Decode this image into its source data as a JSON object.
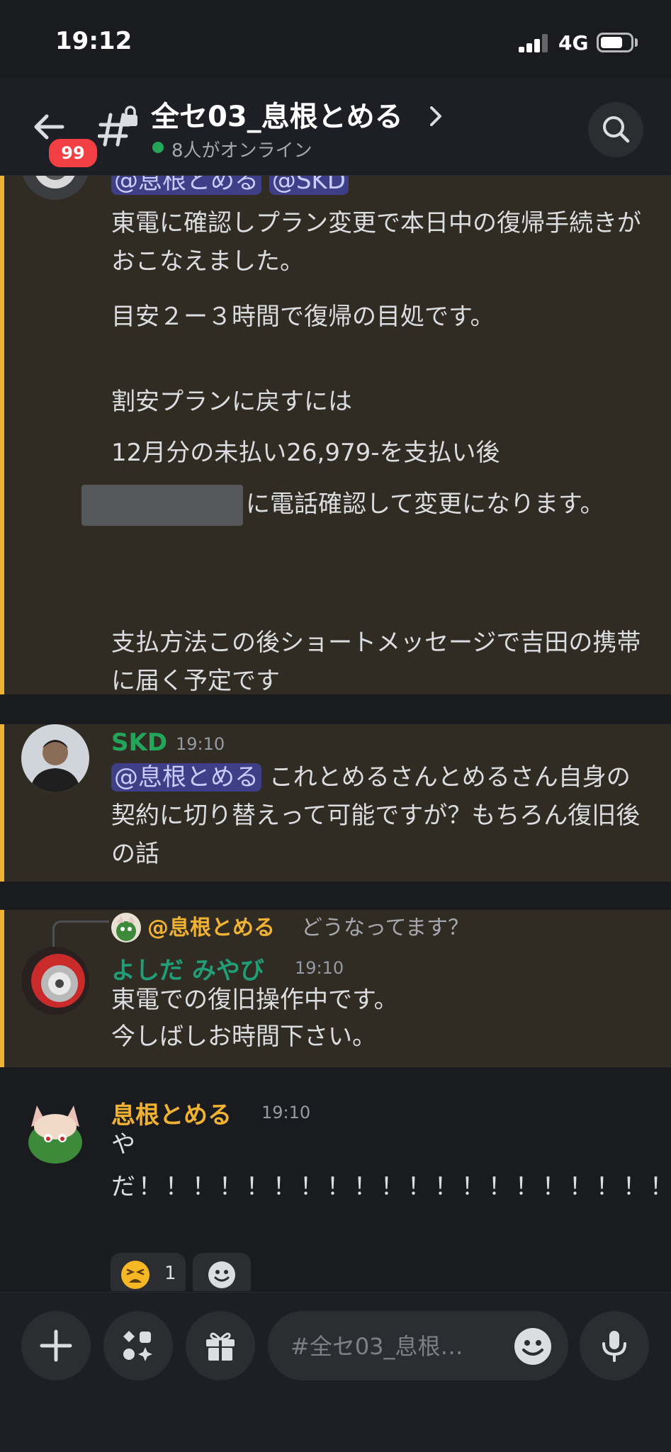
{
  "status_bar": {
    "time": "19:12",
    "network": "4G"
  },
  "header": {
    "unread_badge": "99",
    "channel_name": "全セ03_息根とめる",
    "online_text": "8人がオンライン"
  },
  "messages": {
    "first": {
      "mentions": [
        "@息根とめる",
        "@SKD"
      ],
      "line1": "東電に確認しプラン変更で本日中の復帰手続きがおこなえました。",
      "line2": "目安２ー３時間で復帰の目処です。",
      "line3": "割安プランに戻すには",
      "line4": "12月分の未払い26,979-を支払い後",
      "line5": "に電話確認して変更になります。",
      "line6": "支払方法この後ショートメッセージで吉田の携帯に届く予定です"
    },
    "skd": {
      "username": "SKD",
      "timestamp": "19:10",
      "mention": "@息根とめる",
      "text": " これとめるさんとめるさん自身の契約に切り替えって可能ですが？もちろん復旧後の話"
    },
    "yoshida": {
      "reply_name": "@息根とめる",
      "reply_text": "どうなってます？",
      "username": "よしだ みやび",
      "timestamp": "19:10",
      "line1": "東電での復旧操作中です。",
      "line2": "今しばしお時間下さい。"
    },
    "ikine": {
      "username": "息根とめる",
      "timestamp": "19:10",
      "line1": "や",
      "line2": "だ！！！！！！！！！！！！！！！！！！！！！！！！！！",
      "reaction_count": "1"
    }
  },
  "composer": {
    "placeholder": "#全セ03_息根…"
  },
  "colors": {
    "highlight_bg": "#302b23",
    "highlight_bar": "#f0b232",
    "skd_name": "#23a55a",
    "yoshida_name": "#1f9e78",
    "ikine_name": "#f0b232",
    "mention_bg": "#3d3f87"
  },
  "icons": [
    "back-arrow-icon",
    "hash-lock-icon",
    "chevron-right-icon",
    "search-icon",
    "plus-icon",
    "apps-icon",
    "gift-icon",
    "emoji-icon",
    "microphone-icon"
  ]
}
